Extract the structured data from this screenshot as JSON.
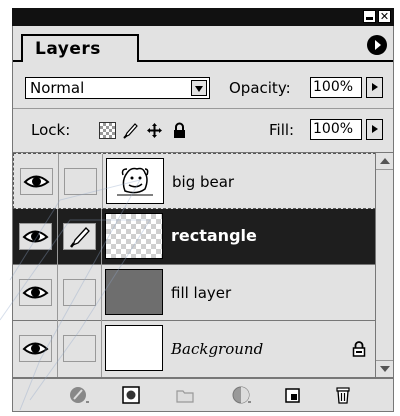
{
  "panel": {
    "tab_label": "Layers",
    "window_controls": {
      "minimize_icon": "minimize-icon",
      "close_icon": "close-icon",
      "close_glyph": "✕"
    },
    "menu_icon": "palette-menu-icon"
  },
  "options": {
    "blend_mode": "Normal",
    "opacity_label": "Opacity:",
    "opacity_value": "100%",
    "lock_label": "Lock:",
    "fill_label": "Fill:",
    "fill_value": "100%",
    "lock_icons": [
      "lock-transparency-icon",
      "lock-image-icon",
      "lock-position-icon",
      "lock-all-icon"
    ]
  },
  "layers": [
    {
      "name": "big bear",
      "visible": true,
      "thumb": "bear-drawing",
      "selected": false,
      "locked": false
    },
    {
      "name": "rectangle",
      "visible": true,
      "thumb": "transparent",
      "selected": true,
      "locked": false
    },
    {
      "name": "fill layer",
      "visible": true,
      "thumb": "gray-fill",
      "selected": false,
      "locked": false
    },
    {
      "name": "Background",
      "visible": true,
      "thumb": "white",
      "selected": false,
      "locked": true
    }
  ],
  "bottom_bar": {
    "icons": [
      "layer-style-icon",
      "add-mask-icon",
      "new-set-icon",
      "new-adjustment-layer-icon",
      "new-layer-icon",
      "delete-layer-icon"
    ]
  },
  "colors": {
    "panel_bg": "#e2e2e2",
    "selected_row": "#1e1e1e",
    "fill_thumb": "#6e6e6e",
    "title_bar": "#111111"
  }
}
